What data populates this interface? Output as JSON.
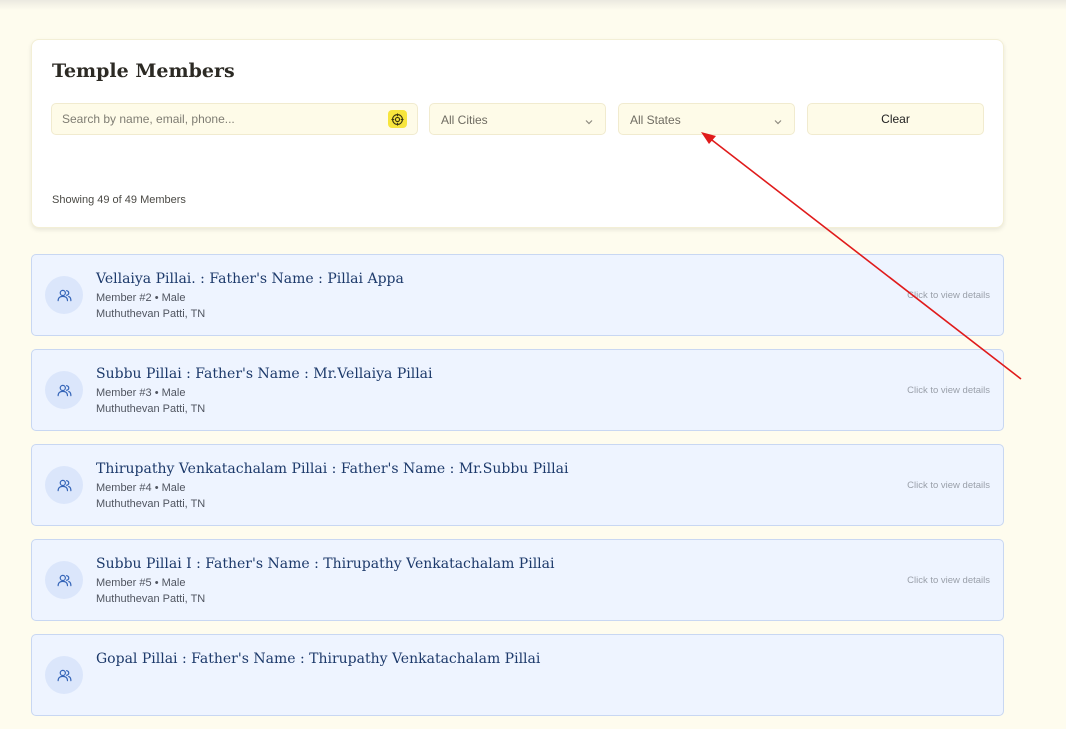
{
  "page": {
    "title": "Temple Members",
    "showing": "Showing 49 of 49 Members"
  },
  "filters": {
    "search_placeholder": "Search by name, email, phone...",
    "city_selected": "All Cities",
    "state_selected": "All States",
    "clear_label": "Clear"
  },
  "members": [
    {
      "name": "Vellaiya Pillai. : Father's Name : Pillai Appa",
      "meta": "Member #2 • Male",
      "location": "Muthuthevan Patti, TN",
      "hint": "Click to view details"
    },
    {
      "name": "Subbu Pillai : Father's Name : Mr.Vellaiya Pillai",
      "meta": "Member #3 • Male",
      "location": "Muthuthevan Patti, TN",
      "hint": "Click to view details"
    },
    {
      "name": "Thirupathy Venkatachalam Pillai : Father's Name : Mr.Subbu Pillai",
      "meta": "Member #4 • Male",
      "location": "Muthuthevan Patti, TN",
      "hint": "Click to view details"
    },
    {
      "name": "Subbu Pillai I : Father's Name : Thirupathy Venkatachalam Pillai",
      "meta": "Member #5 • Male",
      "location": "Muthuthevan Patti, TN",
      "hint": "Click to view details"
    },
    {
      "name": "Gopal Pillai : Father's Name : Thirupathy Venkatachalam Pillai",
      "meta": "",
      "location": "",
      "hint": ""
    }
  ],
  "icons": {
    "search_action": "target-icon",
    "dropdown": "chevron-down-icon",
    "member_avatar": "users-icon"
  },
  "colors": {
    "page_background": "#fefcee",
    "card_background": "#eef4ff",
    "card_border": "#c8d7f2",
    "name_text": "#1d3a6b",
    "accent_yellow": "#f7e53d",
    "annotation_arrow": "#e01b1b"
  }
}
